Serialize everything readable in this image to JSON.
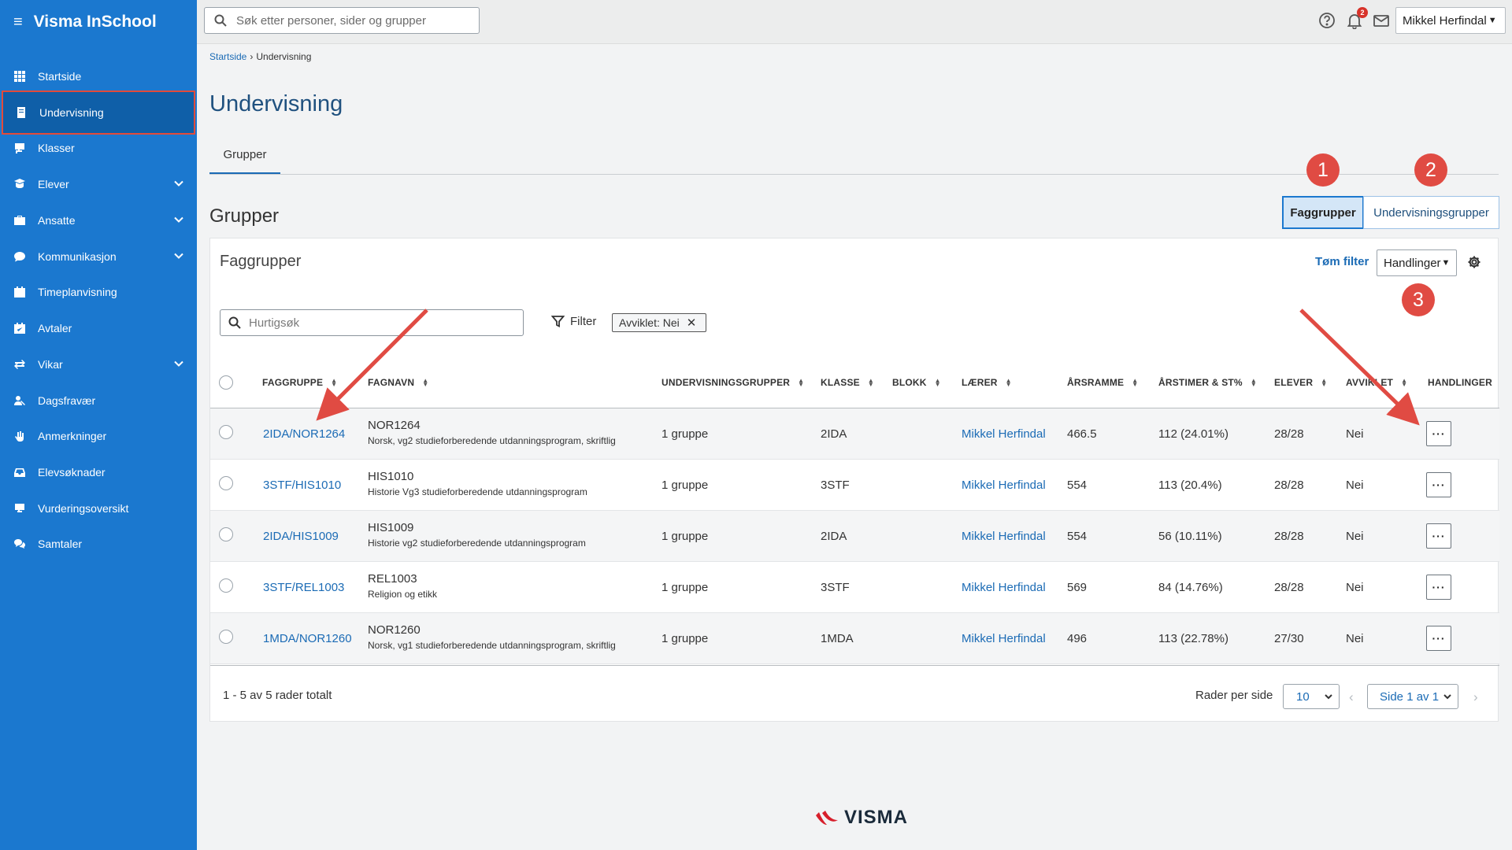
{
  "app": {
    "title": "Visma InSchool",
    "brand_logo_text": "VISMA"
  },
  "sidebar": {
    "items": [
      {
        "label": "Startside",
        "icon": "grid-icon"
      },
      {
        "label": "Undervisning",
        "icon": "book-icon",
        "active": true
      },
      {
        "label": "Klasser",
        "icon": "classroom-icon"
      },
      {
        "label": "Elever",
        "icon": "student-icon",
        "expandable": true
      },
      {
        "label": "Ansatte",
        "icon": "briefcase-icon",
        "expandable": true
      },
      {
        "label": "Kommunikasjon",
        "icon": "chat-icon",
        "expandable": true
      },
      {
        "label": "Timeplanvisning",
        "icon": "calendar-icon"
      },
      {
        "label": "Avtaler",
        "icon": "calendar-check-icon"
      },
      {
        "label": "Vikar",
        "icon": "swap-icon",
        "expandable": true
      },
      {
        "label": "Dagsfravær",
        "icon": "user-absence-icon"
      },
      {
        "label": "Anmerkninger",
        "icon": "hand-icon"
      },
      {
        "label": "Elevsøknader",
        "icon": "inbox-icon"
      },
      {
        "label": "Vurderingsoversikt",
        "icon": "assessment-icon"
      },
      {
        "label": "Samtaler",
        "icon": "conversation-icon"
      }
    ]
  },
  "header": {
    "search_placeholder": "Søk etter personer, sider og grupper",
    "notification_count": "2",
    "user_name": "Mikkel Herfindal"
  },
  "breadcrumb": {
    "home": "Startside",
    "current": "Undervisning"
  },
  "page": {
    "title": "Undervisning",
    "tab": "Grupper",
    "section_title": "Grupper"
  },
  "toggle": {
    "faggrupper": "Faggrupper",
    "undervisningsgrupper": "Undervisningsgrupper"
  },
  "annotations": [
    "1",
    "2",
    "3"
  ],
  "panel": {
    "title": "Faggrupper",
    "clear_filter": "Tøm filter",
    "actions_button": "Handlinger",
    "quick_search_placeholder": "Hurtigsøk",
    "filter_label": "Filter",
    "filter_chip": "Avviklet: Nei"
  },
  "table": {
    "columns": [
      "FAGGRUPPE",
      "FAGNAVN",
      "UNDERVISNINGSGRUPPER",
      "KLASSE",
      "BLOKK",
      "LÆRER",
      "ÅRSRAMME",
      "ÅRSTIMER & ST%",
      "ELEVER",
      "AVVIKLET",
      "HANDLINGER"
    ],
    "rows": [
      {
        "faggruppe": "2IDA/NOR1264",
        "fagkode": "NOR1264",
        "fagnavn": "Norsk, vg2 studieforberedende utdanningsprogram, skriftlig",
        "undervisningsgrupper": "1 gruppe",
        "klasse": "2IDA",
        "laerer": "Mikkel Herfindal",
        "arsramme": "466.5",
        "arstimer": "112 (24.01%)",
        "elever": "28/28",
        "avviklet": "Nei"
      },
      {
        "faggruppe": "3STF/HIS1010",
        "fagkode": "HIS1010",
        "fagnavn": "Historie Vg3 studieforberedende utdanningsprogram",
        "undervisningsgrupper": "1 gruppe",
        "klasse": "3STF",
        "laerer": "Mikkel Herfindal",
        "arsramme": "554",
        "arstimer": "113 (20.4%)",
        "elever": "28/28",
        "avviklet": "Nei"
      },
      {
        "faggruppe": "2IDA/HIS1009",
        "fagkode": "HIS1009",
        "fagnavn": "Historie vg2 studieforberedende utdanningsprogram",
        "undervisningsgrupper": "1 gruppe",
        "klasse": "2IDA",
        "laerer": "Mikkel Herfindal",
        "arsramme": "554",
        "arstimer": "56 (10.11%)",
        "elever": "28/28",
        "avviklet": "Nei"
      },
      {
        "faggruppe": "3STF/REL1003",
        "fagkode": "REL1003",
        "fagnavn": "Religion og etikk",
        "undervisningsgrupper": "1 gruppe",
        "klasse": "3STF",
        "laerer": "Mikkel Herfindal",
        "arsramme": "569",
        "arstimer": "84 (14.76%)",
        "elever": "28/28",
        "avviklet": "Nei"
      },
      {
        "faggruppe": "1MDA/NOR1260",
        "fagkode": "NOR1260",
        "fagnavn": "Norsk, vg1 studieforberedende utdanningsprogram, skriftlig",
        "undervisningsgrupper": "1 gruppe",
        "klasse": "1MDA",
        "laerer": "Mikkel Herfindal",
        "arsramme": "496",
        "arstimer": "113 (22.78%)",
        "elever": "27/30",
        "avviklet": "Nei"
      }
    ]
  },
  "pagination": {
    "summary": "1 - 5 av 5 rader totalt",
    "rows_per_page_label": "Rader per side",
    "rows_per_page": "10",
    "page": "Side 1 av 1"
  },
  "colors": {
    "sidebar": "#1b78cf",
    "sidebar_active": "#0f5fa8",
    "highlight": "#e24b3a",
    "link": "#1b6bb5",
    "annotation": "#e04b43"
  }
}
